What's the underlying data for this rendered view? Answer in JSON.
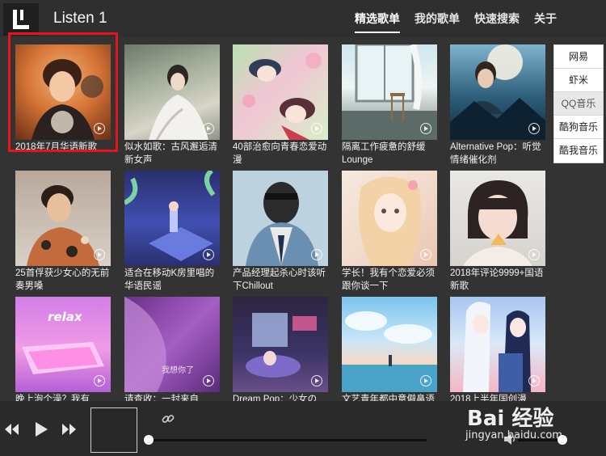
{
  "header": {
    "app_title": "Listen 1",
    "nav": [
      {
        "label": "精选歌单",
        "active": true
      },
      {
        "label": "我的歌单",
        "active": false
      },
      {
        "label": "快速搜索",
        "active": false
      },
      {
        "label": "关于",
        "active": false
      }
    ]
  },
  "sources": [
    {
      "label": "网易",
      "active": false
    },
    {
      "label": "虾米",
      "active": false
    },
    {
      "label": "QQ音乐",
      "active": true
    },
    {
      "label": "酷狗音乐",
      "active": false
    },
    {
      "label": "酷我音乐",
      "active": false
    }
  ],
  "playlists": [
    {
      "title": "2018年7月华语新歌"
    },
    {
      "title": "似水如歌：古风邂逅清新女声"
    },
    {
      "title": "40部治愈向青春恋爱动漫"
    },
    {
      "title": "隔离工作疲惫的舒缓Lounge"
    },
    {
      "title": "Alternative Pop：听觉情绪催化剂"
    },
    {
      "title": "25首俘获少女心的无前奏男嗓"
    },
    {
      "title": "适合在移动K房里唱的华语民谣"
    },
    {
      "title": "产品经理起杀心时该听下Chillout"
    },
    {
      "title": "学长！我有个恋爱必须跟你谈一下"
    },
    {
      "title": "2018年评论9999+国语新歌"
    },
    {
      "title": "晚上泡个澡？我有"
    },
    {
      "title": "请查收：一封来自"
    },
    {
      "title": "Dream Pop：少女の"
    },
    {
      "title": "文艺青年都中意僻鼻语"
    },
    {
      "title": "2018上半年国创漫"
    }
  ],
  "cover_text": {
    "relax": "relax",
    "miss_you": "我想你了"
  },
  "player": {
    "prev_icon": "prev-icon",
    "play_icon": "play-icon",
    "next_icon": "next-icon",
    "link_icon": "link-icon",
    "volume_icon": "volume-icon",
    "progress": 0
  },
  "watermark": {
    "brand": "Bai 经验",
    "url": "jingyan.baidu.com"
  },
  "colors": {
    "background": "#333333",
    "highlight": "#e8141b"
  }
}
